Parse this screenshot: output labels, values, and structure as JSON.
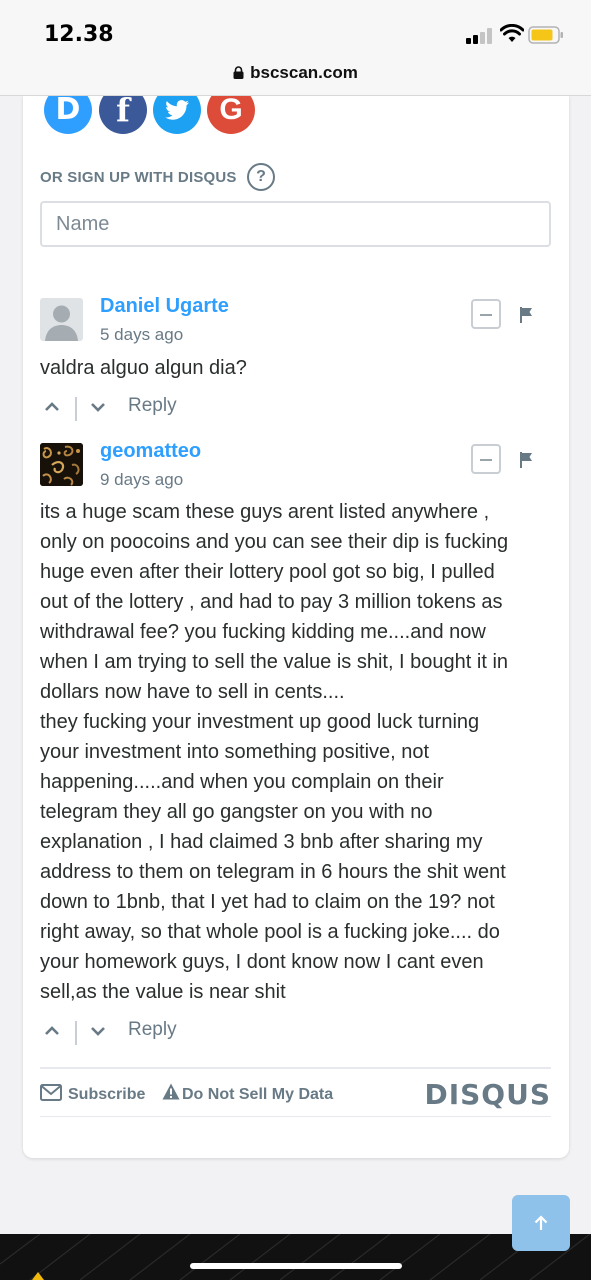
{
  "status_bar": {
    "time": "12.38"
  },
  "browser": {
    "url": "bscscan.com"
  },
  "social_logins": [
    {
      "icon": "disqus-icon",
      "glyph": "D",
      "color": "#2e9fff"
    },
    {
      "icon": "facebook-icon",
      "glyph": "f",
      "color": "#3b5998"
    },
    {
      "icon": "twitter-icon",
      "glyph": "t",
      "color": "#1da1f2"
    },
    {
      "icon": "google-icon",
      "glyph": "G",
      "color": "#dd4b39"
    }
  ],
  "signup": {
    "label": "OR SIGN UP WITH DISQUS",
    "help_glyph": "?",
    "name_placeholder": "Name"
  },
  "comments": [
    {
      "author": "Daniel Ugarte",
      "age": "5 days ago",
      "text": "valdra alguo algun dia?",
      "reply_label": "Reply"
    },
    {
      "author": "geomatteo",
      "age": "9 days ago",
      "text": "its a huge scam these guys arent listed anywhere ,\nonly on poocoins and you can see their dip is fucking\nhuge even after their lottery pool got so big, I pulled\nout of the lottery , and had to pay 3 million tokens as\nwithdrawal fee? you fucking kidding me....and now\nwhen I am trying to sell the value is shit, I bought it in\ndollars now have to sell in cents....\nthey fucking your investment up good luck turning\nyour investment into something positive, not\nhappening.....and when you complain on their\ntelegram they all go gangster on you with no\nexplanation , I had claimed 3 bnb after sharing my\naddress to them on telegram in 6 hours the shit went\ndown to 1bnb, that I yet had to claim on the 19? not\nright away, so that whole pool is a fucking joke.... do\nyour homework guys, I dont know now I cant even\nsell,as the value is near shit",
      "reply_label": "Reply"
    }
  ],
  "footer": {
    "subscribe_label": "Subscribe",
    "do_not_sell_label": "Do Not Sell My Data",
    "brand": "DISQUS"
  }
}
